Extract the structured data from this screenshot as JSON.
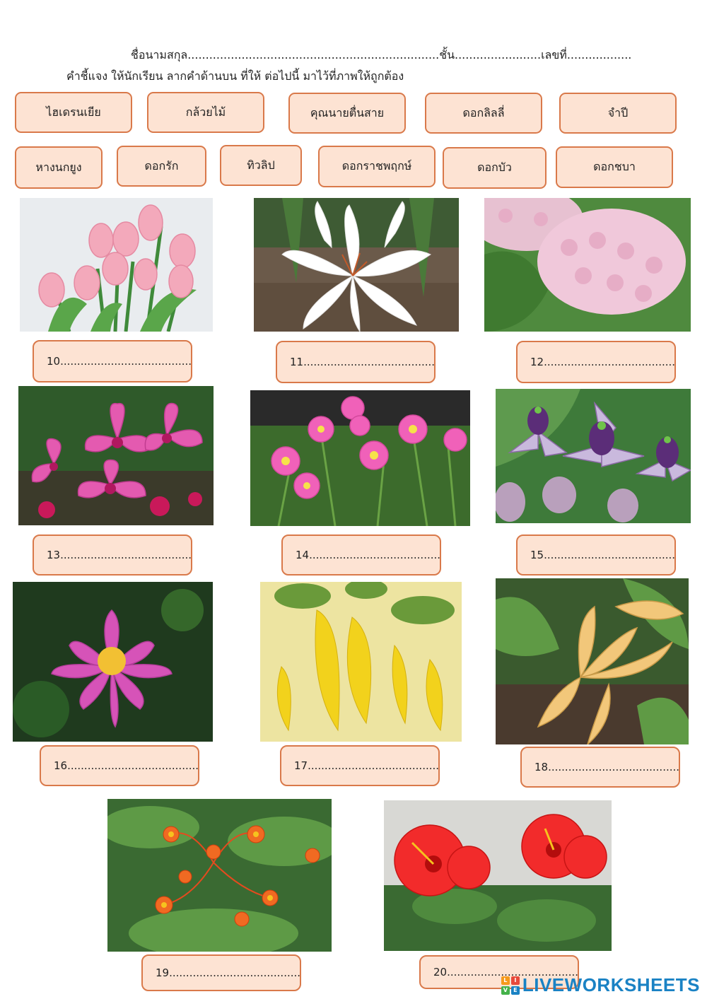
{
  "header": {
    "name_line": "ชื่อนามสกุล......................................................................ชั้น........................เลขที่..................",
    "instruction": "คำชี้แจง  ให้นักเรียน ลากคำด้านบน ที่ให้  ต่อไปนี้  มาไว้ที่ภาพให้ถูกต้อง"
  },
  "word_bank": [
    "ไฮเดรนเยีย",
    "กล้วยไม้",
    "คุณนายตื่นสาย",
    "ดอกลิลลี่",
    "จำปี",
    "หางนกยูง",
    "ดอกรัก",
    "ทิวลิป",
    "ดอกราชพฤกษ์",
    "ดอกบัว",
    "ดอกชบา"
  ],
  "answers": [
    "10.......................................",
    "11.......................................",
    "12.......................................",
    "13.......................................",
    "14.......................................",
    "15.......................................",
    "16.......................................",
    "17.......................................",
    "18.......................................",
    "19.......................................",
    "20......................................."
  ],
  "photos": [
    "tulip-photo",
    "lily-photo",
    "hydrangea-photo",
    "orchid-photo",
    "portulaca-photo",
    "crown-flower-photo",
    "lotus-photo",
    "golden-shower-photo",
    "champak-photo",
    "peacock-flower-photo",
    "hibiscus-photo"
  ],
  "footer": {
    "logo_text": "LIVEWORKSHEETS"
  },
  "colors": {
    "box_fill": "#fde3d3",
    "box_border": "#d9794a",
    "logo_blue": "#1a82c4"
  }
}
